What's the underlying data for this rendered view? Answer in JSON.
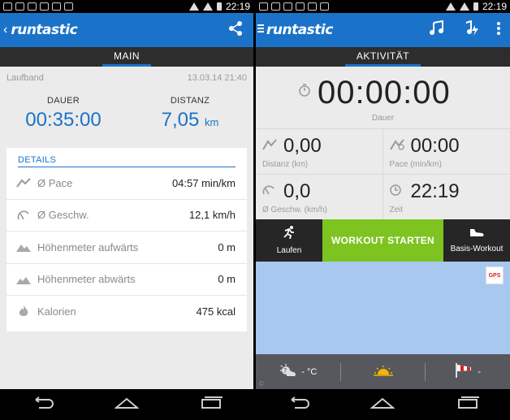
{
  "status": {
    "time": "22:19"
  },
  "left": {
    "app_logo": "runtastic",
    "tab": "MAIN",
    "activity_type": "Laufband",
    "datetime": "13.03.14 21:40",
    "summary": {
      "duration_label": "DAUER",
      "duration_value": "00:35:00",
      "distance_label": "DISTANZ",
      "distance_value": "7,05",
      "distance_unit": "km"
    },
    "details_title": "DETAILS",
    "details": [
      {
        "icon": "pace-icon",
        "label": "Ø Pace",
        "value": "04:57 min/km"
      },
      {
        "icon": "speed-icon",
        "label": "Ø Geschw.",
        "value": "12,1  km/h"
      },
      {
        "icon": "elevation-up-icon",
        "label": "Höhenmeter aufwärts",
        "value": "0 m"
      },
      {
        "icon": "elevation-down-icon",
        "label": "Höhenmeter abwärts",
        "value": "0 m"
      },
      {
        "icon": "flame-icon",
        "label": "Kalorien",
        "value": "475 kcal"
      }
    ]
  },
  "right": {
    "app_logo": "runtastic",
    "tab": "AKTIVITÄT",
    "duration_value": "00:00:00",
    "duration_label": "Dauer",
    "stats": [
      {
        "icon": "distance-icon",
        "value": "0,00",
        "label": "Distanz (km)"
      },
      {
        "icon": "pace-icon",
        "value": "00:00",
        "label": "Pace (min/km)"
      },
      {
        "icon": "speed-icon",
        "value": "0,0",
        "label": "Ø Geschw. (km/h)"
      },
      {
        "icon": "clock-icon",
        "value": "22:19",
        "label": "Zeit"
      }
    ],
    "activity_button": "Laufen",
    "start_button": "WORKOUT STARTEN",
    "workout_button": "Basis-Workout",
    "gps_label": "GPS",
    "weather": {
      "temperature": "- °C",
      "wind": "-"
    },
    "map_attribution": "©"
  },
  "colors": {
    "brand_blue": "#1b73c9",
    "start_green": "#7dc421"
  }
}
